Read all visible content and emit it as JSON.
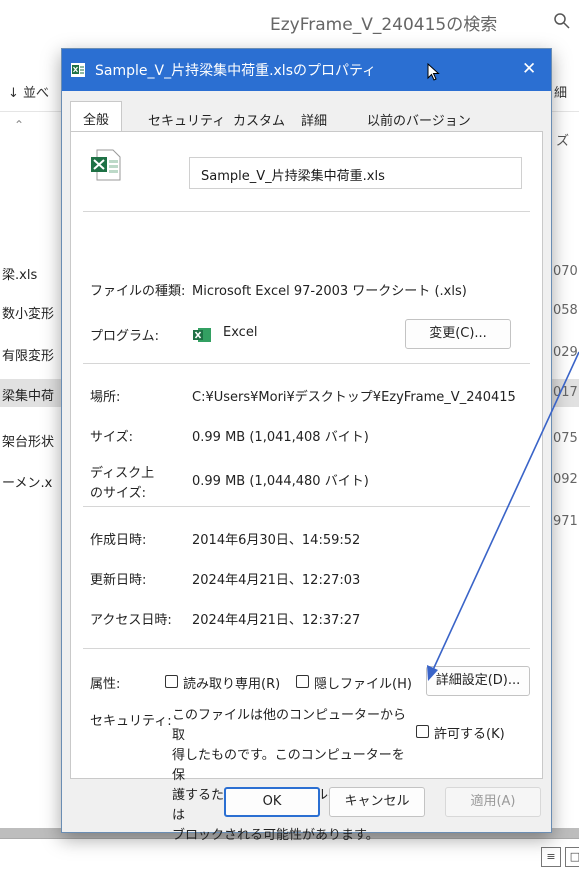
{
  "explorer": {
    "search_text": "EzyFrame_V_240415の検索",
    "sort_label": "↓ 並べ",
    "detail_label": "細",
    "size_header": "ズ",
    "rows": [
      {
        "name": "梁.xls",
        "size": "070",
        "selected": false
      },
      {
        "name": "数小変形",
        "size": "058",
        "selected": false
      },
      {
        "name": "有限変形",
        "size": "029",
        "selected": false
      },
      {
        "name": "梁集中荷",
        "size": "017",
        "selected": true
      },
      {
        "name": "架台形状",
        "size": "075",
        "selected": false
      },
      {
        "name": "ーメン.x",
        "size": "092",
        "selected": false
      },
      {
        "name": "",
        "size": "971",
        "selected": false
      }
    ]
  },
  "dialog": {
    "title": "Sample_V_片持梁集中荷重.xlsのプロパティ",
    "tabs": [
      "全般",
      "セキュリティ",
      "カスタム",
      "詳細",
      "以前のバージョン"
    ],
    "filename": "Sample_V_片持梁集中荷重.xls",
    "file_type_label": "ファイルの種類:",
    "file_type_value": "Microsoft Excel 97-2003 ワークシート (.xls)",
    "program_label": "プログラム:",
    "program_value": "Excel",
    "change_button": "変更(C)...",
    "location_label": "場所:",
    "location_value": "C:¥Users¥Mori¥デスクトップ¥EzyFrame_V_240415",
    "size_label": "サイズ:",
    "size_value": "0.99 MB (1,041,408 バイト)",
    "disk_size_label_1": "ディスク上",
    "disk_size_label_2": "のサイズ:",
    "disk_size_value": "0.99 MB (1,044,480 バイト)",
    "created_label": "作成日時:",
    "created_value": "2014年6月30日、14:59:52",
    "modified_label": "更新日時:",
    "modified_value": "2024年4月21日、12:27:03",
    "accessed_label": "アクセス日時:",
    "accessed_value": "2024年4月21日、12:37:27",
    "attributes_label": "属性:",
    "readonly_label": "読み取り専用(R)",
    "hidden_label": "隠しファイル(H)",
    "advanced_button": "詳細設定(D)...",
    "security_label": "セキュリティ:",
    "security_lines": [
      "このファイルは他のコンピューターから取",
      "得したものです。このコンピューターを保",
      "護するため、このファイルへのアクセスは",
      "ブロックされる可能性があります。"
    ],
    "allow_label": "許可する(K)",
    "ok_button": "OK",
    "cancel_button": "キャンセル",
    "apply_button": "適用(A)"
  },
  "colors": {
    "titlebar": "#2b6fd2",
    "annotation_arrow": "#3a64c8",
    "excel_green": "#1e7145"
  }
}
